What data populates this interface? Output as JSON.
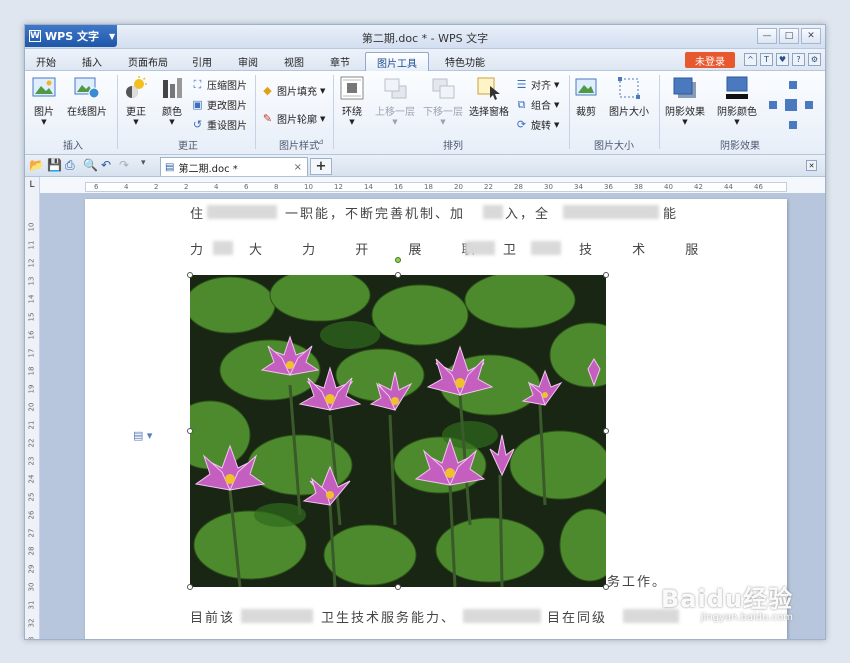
{
  "window": {
    "app_button": "WPS 文字",
    "title": "第二期.doc * - WPS 文字"
  },
  "menu": {
    "tabs": [
      "开始",
      "插入",
      "页面布局",
      "引用",
      "审阅",
      "视图",
      "章节",
      "图片工具",
      "特色功能"
    ],
    "active": "图片工具",
    "login": "未登录"
  },
  "ribbon": {
    "insert_picture": "图片",
    "online_picture": "在线图片",
    "group_insert": "插入",
    "correct": "更正",
    "color": "颜色",
    "compress": "压缩图片",
    "change": "更改图片",
    "reset": "重设图片",
    "group_correct": "更正",
    "fill": "图片填充",
    "outline": "图片轮廓",
    "group_style": "图片样式",
    "wrap": "环绕",
    "bring_forward": "上移一层",
    "send_backward": "下移一层",
    "selection_pane": "选择窗格",
    "align": "对齐",
    "group": "组合",
    "rotate": "旋转",
    "group_arrange": "排列",
    "crop": "裁剪",
    "size": "图片大小",
    "group_size": "图片大小",
    "shadow": "阴影效果",
    "shadow_color": "阴影颜色",
    "group_shadow": "阴影效果"
  },
  "docbar": {
    "doc_tab": "第二期.doc *",
    "close": "×",
    "new_tab": "+"
  },
  "ruler": {
    "h_ticks": [
      "6",
      "4",
      "2",
      "2",
      "4",
      "6",
      "8",
      "10",
      "12",
      "14",
      "16",
      "18",
      "20",
      "22",
      "28",
      "30",
      "34",
      "36",
      "38",
      "40",
      "42",
      "44",
      "46"
    ],
    "v_ticks": [
      "10",
      "11",
      "12",
      "13",
      "14",
      "15",
      "16",
      "17",
      "18",
      "19",
      "20",
      "21",
      "22",
      "23",
      "24",
      "25",
      "26",
      "27",
      "28",
      "29",
      "30",
      "31",
      "32",
      "33"
    ]
  },
  "document": {
    "line1_a": "住",
    "line1_b": "一职能，不断完善机制、加",
    "line1_c": "入，全",
    "line1_d": "能",
    "line2_a": "力",
    "line2_b": "大 力 开 展 职",
    "line2_c": "卫",
    "line2_d": "技 术 服",
    "line3": "务工作。",
    "line4_a": "目前该",
    "line4_b": "卫生技术服务能力、",
    "line4_c": "目在同级"
  },
  "watermark": {
    "brand": "Baidu经验",
    "url": "jingyan.baidu.com"
  }
}
